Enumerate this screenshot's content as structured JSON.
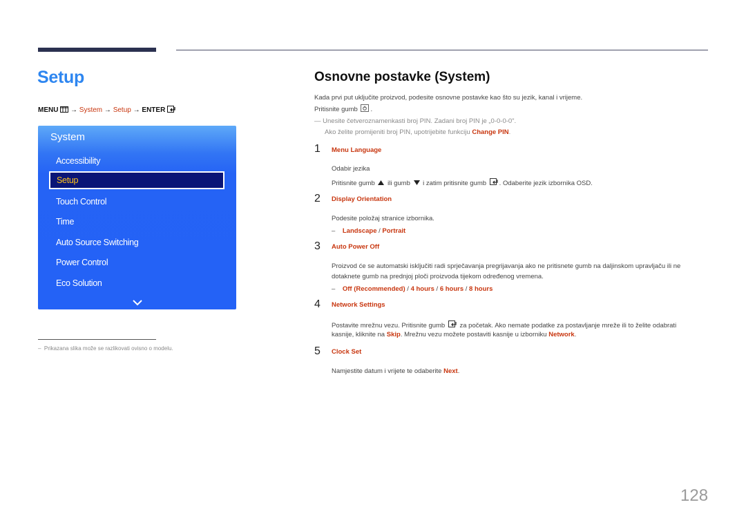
{
  "header": {
    "page_title": "Setup"
  },
  "menu_path": {
    "menu_label": "MENU",
    "menu_icon": "menu-grid-icon",
    "arrow": "→",
    "step1": "System",
    "step2": "Setup",
    "enter_label": "ENTER",
    "enter_icon": "enter-icon"
  },
  "osd": {
    "title": "System",
    "items": [
      {
        "label": "Accessibility",
        "selected": false
      },
      {
        "label": "Setup",
        "selected": true
      },
      {
        "label": "Touch Control",
        "selected": false
      },
      {
        "label": "Time",
        "selected": false
      },
      {
        "label": "Auto Source Switching",
        "selected": false
      },
      {
        "label": "Power Control",
        "selected": false
      },
      {
        "label": "Eco Solution",
        "selected": false
      }
    ],
    "more_icon": "chevron-down-icon",
    "colors": {
      "background": "#2462f6",
      "selected_bg": "#0a1577",
      "selected_text": "#ffc21a"
    }
  },
  "footnote": {
    "dash": "–",
    "text": "Prikazana slika može se razlikovati ovisno o modelu."
  },
  "main": {
    "title": "Osnovne postavke (System)",
    "intro_line1": "Kada prvi put uključite proizvod, podesite osnovne postavke kao što su jezik, kanal i vrijeme.",
    "intro_line2_pre": "Pritisnite gumb",
    "intro_line2_icon": "power-button-icon",
    "intro_line2_post": ".",
    "note_dash": "—",
    "note_line1": "Unesite četveroznamenkasti broj PIN. Zadani broj PIN je „0-0-0-0\".",
    "note_line2_pre": "Ako želite promijeniti broj PIN, upotrijebite funkciju",
    "note_line2_link": "Change PIN",
    "note_line2_post": ".",
    "items": [
      {
        "number": "1",
        "title": "Menu Language",
        "line1": "Odabir jezika",
        "line2_a": "Pritisnite gumb",
        "line2_b": "ili gumb",
        "line2_c": "i zatim pritisnite gumb",
        "line2_d": ". Odaberite jezik izbornika OSD."
      },
      {
        "number": "2",
        "title": "Display Orientation",
        "line1": "Podesite položaj stranice izbornika.",
        "options": [
          "Landscape",
          "Portrait"
        ]
      },
      {
        "number": "3",
        "title": "Auto Power Off",
        "line1": "Proizvod će se automatski isključiti radi sprječavanja pregrijavanja ako ne pritisnete gumb na daljinskom upravljaču ili ne",
        "line2": "dotaknete gumb na prednjoj ploči proizvoda tijekom određenog vremena.",
        "options": [
          "Off (Recommended)",
          "4 hours",
          "6 hours",
          "8 hours"
        ]
      },
      {
        "number": "4",
        "title": "Network Settings",
        "line1_pre": "Postavite mrežnu vezu. Pritisnite gumb",
        "line1_post": "za početak. Ako nemate podatke za postavljanje mreže ili to želite odabrati",
        "line2_pre": "kasnije, kliknite na",
        "line2_link1": "Skip",
        "line2_mid": ". Mrežnu vezu možete postaviti kasnije u izborniku",
        "line2_link2": "Network",
        "line2_post": "."
      },
      {
        "number": "5",
        "title": "Clock Set",
        "line1_pre": "Namjestite datum i vrijete te odaberite",
        "line1_link": "Next",
        "line1_post": "."
      }
    ],
    "separator": "/",
    "option_dash": "–"
  },
  "page_number": "128",
  "colors": {
    "accent_blue": "#2e86f0",
    "highlight_red": "#c8360f",
    "rule_dark": "#2b3150"
  }
}
